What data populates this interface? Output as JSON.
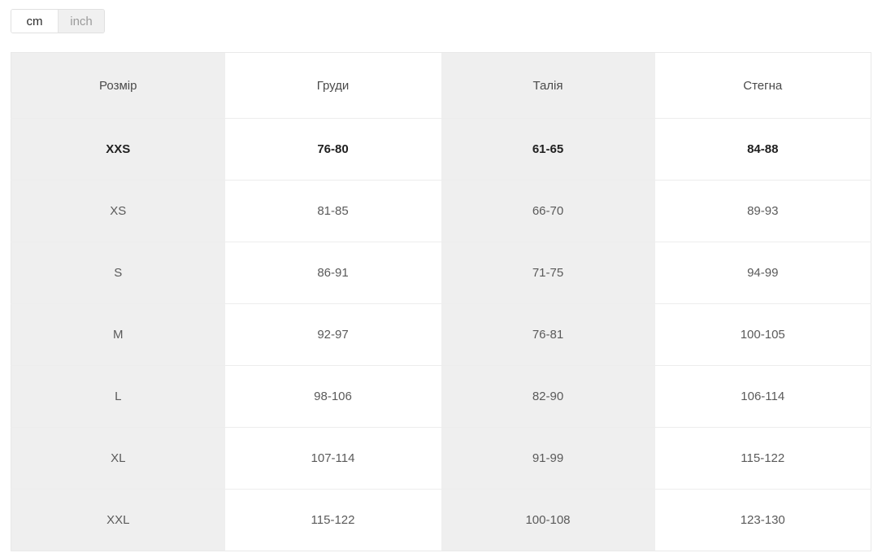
{
  "units": {
    "options": [
      {
        "label": "cm",
        "active": true
      },
      {
        "label": "inch",
        "active": false
      }
    ],
    "selected": "cm"
  },
  "table": {
    "columns": [
      "Розмір",
      "Груди",
      "Талія",
      "Стегна"
    ],
    "rows": [
      {
        "size": "XXS",
        "chest": "76-80",
        "waist": "61-65",
        "hips": "84-88",
        "highlight": true
      },
      {
        "size": "XS",
        "chest": "81-85",
        "waist": "66-70",
        "hips": "89-93",
        "highlight": false
      },
      {
        "size": "S",
        "chest": "86-91",
        "waist": "71-75",
        "hips": "94-99",
        "highlight": false
      },
      {
        "size": "M",
        "chest": "92-97",
        "waist": "76-81",
        "hips": "100-105",
        "highlight": false
      },
      {
        "size": "L",
        "chest": "98-106",
        "waist": "82-90",
        "hips": "106-114",
        "highlight": false
      },
      {
        "size": "XL",
        "chest": "107-114",
        "waist": "91-99",
        "hips": "115-122",
        "highlight": false
      },
      {
        "size": "XXL",
        "chest": "115-122",
        "waist": "100-108",
        "hips": "123-130",
        "highlight": false
      }
    ]
  },
  "colors": {
    "shaded_cell": "#efefef",
    "plain_cell": "#ffffff",
    "text": "#5a5a5a",
    "text_highlight": "#1f1f1f",
    "border": "#ededed",
    "toggle_inactive_bg": "#f0f0f0"
  }
}
